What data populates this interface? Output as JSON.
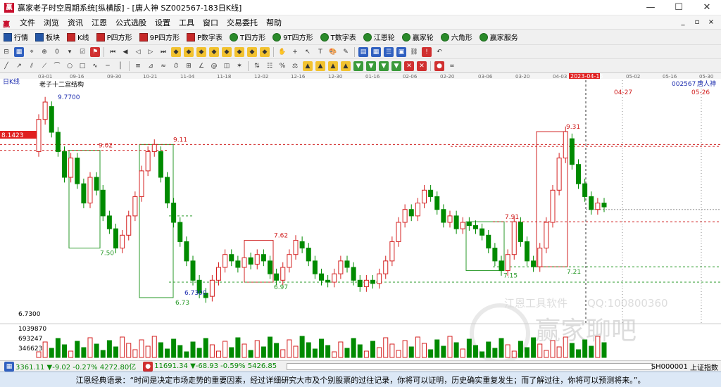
{
  "window": {
    "title": "赢家老子时空周期系统[纵横版] - [唐人神  SZ002567-183日K线]",
    "logo": "赢",
    "minimize": "—",
    "maximize": "☐",
    "close": "✕"
  },
  "menu": {
    "logo": "赢",
    "items": [
      "文件",
      "浏览",
      "资讯",
      "江恩",
      "公式选股",
      "设置",
      "工具",
      "窗口",
      "交易委托",
      "帮助"
    ],
    "right": [
      "_",
      "▫",
      "×"
    ]
  },
  "toolbar1": {
    "items": [
      {
        "label": "行情",
        "icon": "grid-icon"
      },
      {
        "label": "板块",
        "icon": "blocks-icon"
      },
      {
        "label": "K线",
        "icon": "candlestick-icon"
      },
      {
        "label": "P四方形",
        "icon": "p-square-icon"
      },
      {
        "label": "9P四方形",
        "icon": "9p-square-icon"
      },
      {
        "label": "P数字表",
        "icon": "p-table-icon"
      },
      {
        "label": "T四方形",
        "icon": "t-square-icon"
      },
      {
        "label": "9T四方形",
        "icon": "9t-square-icon"
      },
      {
        "label": "T数字表",
        "icon": "t-table-icon"
      },
      {
        "label": "江恩轮",
        "icon": "gann-wheel-icon"
      },
      {
        "label": "赢家轮",
        "icon": "winner-wheel-icon"
      },
      {
        "label": "六角形",
        "icon": "hexagon-icon"
      },
      {
        "label": "赢家服务",
        "icon": "service-icon"
      }
    ]
  },
  "chart_header": {
    "period": "日K线",
    "date_axis": [
      "03-01",
      "09-16",
      "09-30",
      "10-21",
      "11-04",
      "11-18",
      "12-02",
      "12-16",
      "12-30",
      "01-16",
      "02-06",
      "02-20",
      "03-06",
      "03-20",
      "04-03",
      "2023-04-13",
      "05-02",
      "05-16",
      "05-30"
    ],
    "stock_code": "002567",
    "stock_name": "唐人神",
    "current_price": "8.1423",
    "future_dates": [
      "04-27",
      "05-26"
    ],
    "structure_label": "老子十二宫结构"
  },
  "chart_data": {
    "type": "candlestick",
    "price_labels": [
      "9.7700",
      "9.02",
      "9.11",
      "7.50",
      "7.62",
      "6.97",
      "6.7300",
      "6.73",
      "7.91",
      "7.15",
      "9.31",
      "7.21"
    ],
    "y_axis_label": "6.7300",
    "volume_axis": [
      "1039870",
      "693247",
      "346623"
    ],
    "watermark": [
      "江恩工具软件",
      "QQ:100800360",
      "赢家聊吧"
    ],
    "up_color": "#d42020",
    "down_color": "#008a00"
  },
  "index_bar": {
    "sh": "3361.11 ▼-9.02 -0.27% 4272.80亿",
    "sz": "11691.34 ▼-68.93 -0.59% 5426.85",
    "right_code": "SH000001",
    "right_name": "上证指数"
  },
  "status": {
    "quote": "江恩经典语录：“时间是决定市场走势的重要因素，经过详细研究大市及个别股票的过往记录，你将可以证明，历史确实重复发生；而了解过往，你将可以预测将来。”。"
  }
}
